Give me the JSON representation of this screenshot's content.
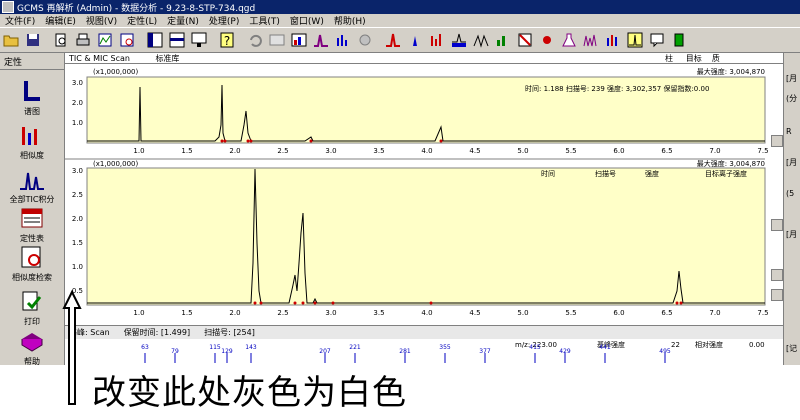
{
  "title": "GCMS 再解析 (Admin) - 数据分析 - 9.23-8-STP-734.qgd",
  "menu": [
    "文件(F)",
    "编辑(E)",
    "视图(V)",
    "定性(L)",
    "定量(N)",
    "处理(P)",
    "工具(T)",
    "窗口(W)",
    "帮助(H)"
  ],
  "left_panel": {
    "title": "定性",
    "items": [
      {
        "label": "谱图",
        "icon": "spectrum-icon"
      },
      {
        "label": "相似度",
        "icon": "similarity-icon"
      },
      {
        "label": "全部TIC积分",
        "icon": "integrate-icon"
      },
      {
        "label": "定性表",
        "icon": "table-icon"
      },
      {
        "label": "相似度检索",
        "icon": "search-icon"
      },
      {
        "label": "打印",
        "icon": "print-icon"
      },
      {
        "label": "帮助",
        "icon": "help-book-icon"
      }
    ]
  },
  "chart_header": {
    "left": "TIC & MIC Scan",
    "middle": "标准库",
    "right_labels": [
      "柱",
      "目标",
      "质"
    ]
  },
  "top_chart": {
    "scale": "(x1,000,000)",
    "max_label": "最大强度: 3,004,870",
    "info": "时间: 1.188  扫描号: 239  强度: 3,302,357  保留指数:0.00",
    "y_ticks": [
      "3.0",
      "2.0",
      "1.0"
    ],
    "x_ticks": [
      "1.0",
      "1.5",
      "2.0",
      "2.5",
      "3.0",
      "3.5",
      "4.0",
      "4.5",
      "5.0",
      "5.5",
      "6.0",
      "6.5",
      "7.0",
      "7.5"
    ]
  },
  "bottom_chart": {
    "scale": "(x1,000,000)",
    "max_label": "最大强度: 3,004,870",
    "headers": [
      "时间",
      "扫描号",
      "强度",
      "目标离子强度"
    ],
    "y_ticks": [
      "3.0",
      "2.5",
      "2.0",
      "1.5",
      "1.0",
      "0.5"
    ],
    "x_ticks": [
      "1.0",
      "1.5",
      "2.0",
      "2.5",
      "3.0",
      "3.5",
      "4.0",
      "4.5",
      "5.0",
      "5.5",
      "6.0",
      "6.5",
      "7.0",
      "7.5"
    ]
  },
  "info_strip": {
    "left": "基峰:  Scan",
    "retention": "保留时间: [1.499]",
    "scan_no": "扫描号: [254]",
    "ma": "m/z: 223.00",
    "intensity_label": "基峰强度",
    "base_value": "22",
    "rel_label": "相对强度",
    "rel_value": "0.00"
  },
  "ms_labels": [
    "63",
    "79",
    "115",
    "129",
    "143",
    "207",
    "221",
    "281",
    "355",
    "377",
    "415",
    "429",
    "441",
    "495"
  ],
  "right_strip": [
    "[月",
    "(分",
    "R",
    "[月",
    "(5",
    "[月",
    "[记"
  ],
  "annotation": "改变此处灰色为白色"
}
